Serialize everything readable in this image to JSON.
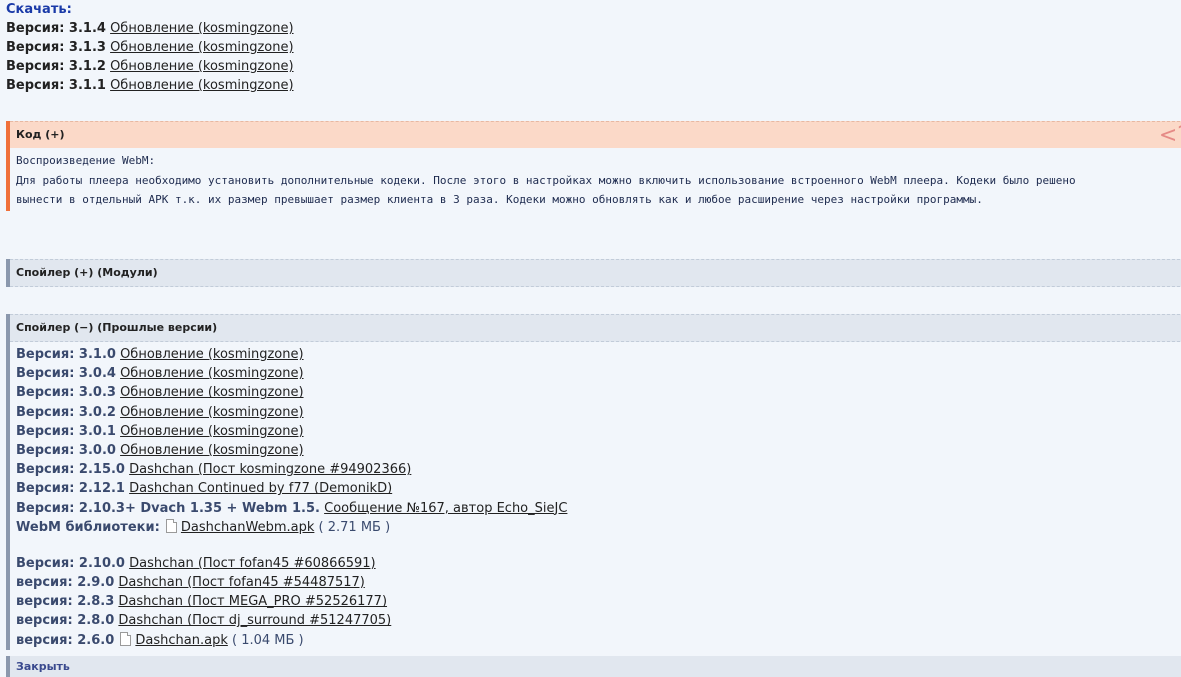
{
  "download": {
    "title": "Скачать:",
    "items": [
      {
        "version": "Версия: 3.1.4",
        "link": "Обновление (kosmingzone)"
      },
      {
        "version": "Версия: 3.1.3",
        "link": "Обновление (kosmingzone)"
      },
      {
        "version": "Версия: 3.1.2",
        "link": "Обновление (kosmingzone)"
      },
      {
        "version": "Версия: 3.1.1",
        "link": "Обновление (kosmingzone)"
      }
    ]
  },
  "code": {
    "header": "Код (+)",
    "arrow": "<?",
    "lines": [
      "Воспроизведение WebM:",
      "Для работы плеера необходимо установить дополнительные кодеки. После этого в настройках можно включить использование встроенного WebM плеера. Кодеки было решено",
      "вынести в отдельный APK т.к. их размер превышает размер клиента в 3 раза. Кодеки можно обновлять как и любое расширение через настройки программы."
    ]
  },
  "spoiler_modules": {
    "header": "Спойлер (+) (Модули)"
  },
  "spoiler_old": {
    "header": "Спойлер (−) (Прошлые версии)",
    "items": [
      {
        "version": "Версия: 3.1.0",
        "link": "Обновление (kosmingzone)"
      },
      {
        "version": "Версия: 3.0.4",
        "link": "Обновление (kosmingzone)"
      },
      {
        "version": "Версия: 3.0.3",
        "link": "Обновление (kosmingzone)"
      },
      {
        "version": "Версия: 3.0.2",
        "link": "Обновление (kosmingzone)"
      },
      {
        "version": "Версия: 3.0.1",
        "link": "Обновление (kosmingzone)"
      },
      {
        "version": "Версия: 3.0.0",
        "link": "Обновление (kosmingzone)"
      },
      {
        "version": "Версия: 2.15.0",
        "link": "Dashchan (Пост kosmingzone #94902366)"
      },
      {
        "version": "Версия: 2.12.1",
        "link": "Dashchan Continued by f77 (DemonikD)"
      },
      {
        "version": "Версия: 2.10.3+ Dvach 1.35 + Webm 1.5.",
        "link": "Сообщение №167, автор Echo_SieJC"
      }
    ],
    "webm": {
      "label": "WebM библиотеки:",
      "file": "DashchanWebm.apk",
      "size": "( 2.71 МБ )"
    },
    "items2": [
      {
        "version": "Версия: 2.10.0",
        "link": "Dashchan (Пост fofan45 #60866591)"
      },
      {
        "version": "версия: 2.9.0",
        "link": "Dashchan (Пост fofan45 #54487517)"
      },
      {
        "version": "версия: 2.8.3",
        "link": "Dashchan (Пост MEGA_PRO #52526177)"
      },
      {
        "version": "версия: 2.8.0",
        "link": "Dashchan (Пост dj_surround #51247705)"
      }
    ],
    "last": {
      "version": "версия: 2.6.0",
      "file": "Dashchan.apk",
      "size": "( 1.04 МБ )"
    }
  },
  "close": "Закрыть"
}
